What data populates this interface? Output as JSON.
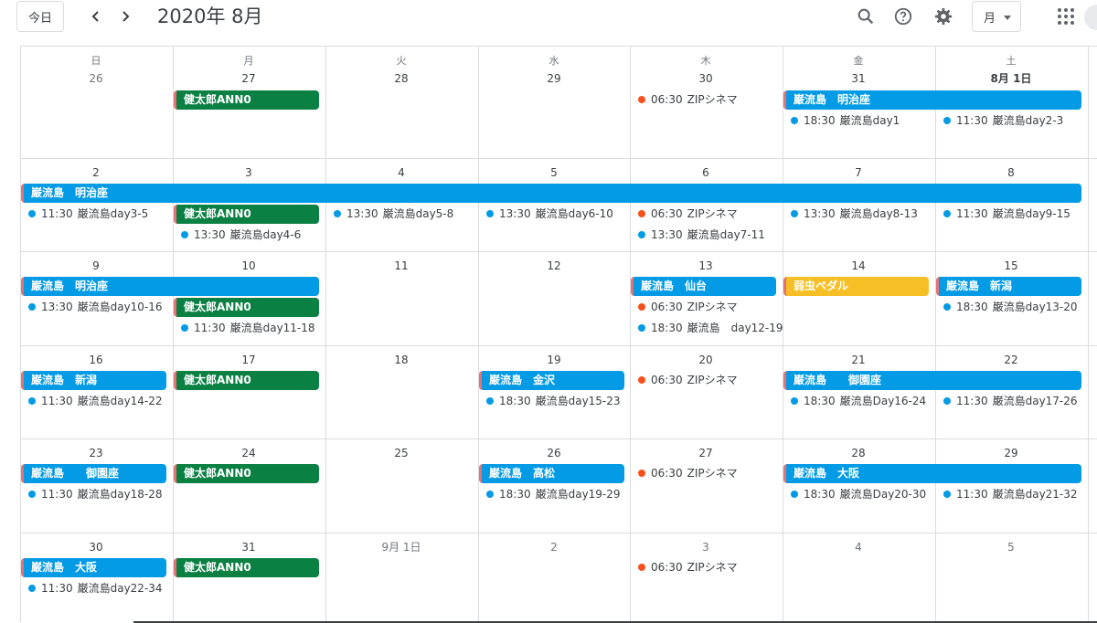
{
  "header": {
    "today_label": "今日",
    "title": "2020年 8月",
    "view_label": "月"
  },
  "colors": {
    "blue": "#039be5",
    "green": "#0b8043",
    "yellow": "#f6bf26",
    "dot_orange": "#f4511e",
    "dot_blue": "#039be5",
    "accent_edge": "#e57373"
  },
  "weekdays": [
    "日",
    "月",
    "火",
    "水",
    "木",
    "金",
    "土"
  ],
  "weeks": [
    {
      "days": [
        {
          "label": "26",
          "other": true
        },
        {
          "label": "27",
          "other": false
        },
        {
          "label": "28",
          "other": false
        },
        {
          "label": "29",
          "other": false
        },
        {
          "label": "30",
          "other": false
        },
        {
          "label": "31",
          "other": false
        },
        {
          "label": "8月 1日",
          "other": false,
          "strong": true
        }
      ],
      "bars": [
        {
          "col": 1,
          "span": 1,
          "row": 0,
          "text": "健太郎ANN0",
          "color": "green"
        },
        {
          "col": 5,
          "span": 2,
          "row": 0,
          "text": "巌流島　明治座",
          "color": "blue"
        }
      ],
      "timed": [
        {
          "col": 4,
          "row": 0,
          "time": "06:30",
          "text": "ZIPシネマ",
          "dot": "orange"
        },
        {
          "col": 5,
          "row": 1,
          "time": "18:30",
          "text": "巌流島day1",
          "dot": "blue"
        },
        {
          "col": 6,
          "row": 1,
          "time": "11:30",
          "text": "巌流島day2-3",
          "dot": "blue"
        }
      ]
    },
    {
      "days": [
        {
          "label": "2"
        },
        {
          "label": "3"
        },
        {
          "label": "4"
        },
        {
          "label": "5"
        },
        {
          "label": "6"
        },
        {
          "label": "7"
        },
        {
          "label": "8"
        }
      ],
      "bars": [
        {
          "col": 0,
          "span": 7,
          "row": 0,
          "text": "巌流島　明治座",
          "color": "blue"
        },
        {
          "col": 1,
          "span": 1,
          "row": 1,
          "text": "健太郎ANN0",
          "color": "green"
        }
      ],
      "timed": [
        {
          "col": 0,
          "row": 1,
          "time": "11:30",
          "text": "巌流島day3-5",
          "dot": "blue"
        },
        {
          "col": 1,
          "row": 2,
          "time": "13:30",
          "text": "巌流島day4-6",
          "dot": "blue"
        },
        {
          "col": 2,
          "row": 1,
          "time": "13:30",
          "text": "巌流島day5-8",
          "dot": "blue"
        },
        {
          "col": 3,
          "row": 1,
          "time": "13:30",
          "text": "巌流島day6-10",
          "dot": "blue"
        },
        {
          "col": 4,
          "row": 1,
          "time": "06:30",
          "text": "ZIPシネマ",
          "dot": "orange"
        },
        {
          "col": 4,
          "row": 2,
          "time": "13:30",
          "text": "巌流島day7-11",
          "dot": "blue"
        },
        {
          "col": 5,
          "row": 1,
          "time": "13:30",
          "text": "巌流島day8-13",
          "dot": "blue"
        },
        {
          "col": 6,
          "row": 1,
          "time": "11:30",
          "text": "巌流島day9-15",
          "dot": "blue"
        }
      ]
    },
    {
      "days": [
        {
          "label": "9"
        },
        {
          "label": "10"
        },
        {
          "label": "11"
        },
        {
          "label": "12"
        },
        {
          "label": "13"
        },
        {
          "label": "14"
        },
        {
          "label": "15"
        }
      ],
      "bars": [
        {
          "col": 0,
          "span": 2,
          "row": 0,
          "text": "巌流島　明治座",
          "color": "blue"
        },
        {
          "col": 1,
          "span": 1,
          "row": 1,
          "text": "健太郎ANN0",
          "color": "green"
        },
        {
          "col": 4,
          "span": 1,
          "row": 0,
          "text": "巌流島　仙台",
          "color": "blue"
        },
        {
          "col": 5,
          "span": 1,
          "row": 0,
          "text": "弱虫ペダル",
          "color": "yellow"
        },
        {
          "col": 6,
          "span": 1,
          "row": 0,
          "text": "巌流島　新潟",
          "color": "blue"
        }
      ],
      "timed": [
        {
          "col": 0,
          "row": 1,
          "time": "13:30",
          "text": "巌流島day10-16",
          "dot": "blue"
        },
        {
          "col": 1,
          "row": 2,
          "time": "11:30",
          "text": "巌流島day11-18",
          "dot": "blue"
        },
        {
          "col": 4,
          "row": 1,
          "time": "06:30",
          "text": "ZIPシネマ",
          "dot": "orange"
        },
        {
          "col": 4,
          "row": 2,
          "time": "18:30",
          "text": "巌流島　day12-19",
          "dot": "blue"
        },
        {
          "col": 6,
          "row": 1,
          "time": "18:30",
          "text": "巌流島day13-20",
          "dot": "blue"
        }
      ]
    },
    {
      "days": [
        {
          "label": "16"
        },
        {
          "label": "17"
        },
        {
          "label": "18"
        },
        {
          "label": "19"
        },
        {
          "label": "20"
        },
        {
          "label": "21"
        },
        {
          "label": "22"
        }
      ],
      "bars": [
        {
          "col": 0,
          "span": 1,
          "row": 0,
          "text": "巌流島　新潟",
          "color": "blue"
        },
        {
          "col": 1,
          "span": 1,
          "row": 0,
          "text": "健太郎ANN0",
          "color": "green"
        },
        {
          "col": 3,
          "span": 1,
          "row": 0,
          "text": "巌流島　金沢",
          "color": "blue"
        },
        {
          "col": 5,
          "span": 2,
          "row": 0,
          "text": "巌流島　　御園座",
          "color": "blue"
        }
      ],
      "timed": [
        {
          "col": 0,
          "row": 1,
          "time": "11:30",
          "text": "巌流島day14-22",
          "dot": "blue"
        },
        {
          "col": 3,
          "row": 1,
          "time": "18:30",
          "text": "巌流島day15-23",
          "dot": "blue"
        },
        {
          "col": 4,
          "row": 0,
          "time": "06:30",
          "text": "ZIPシネマ",
          "dot": "orange"
        },
        {
          "col": 5,
          "row": 1,
          "time": "18:30",
          "text": "巌流島Day16-24",
          "dot": "blue"
        },
        {
          "col": 6,
          "row": 1,
          "time": "11:30",
          "text": "巌流島day17-26",
          "dot": "blue"
        }
      ]
    },
    {
      "days": [
        {
          "label": "23"
        },
        {
          "label": "24"
        },
        {
          "label": "25"
        },
        {
          "label": "26"
        },
        {
          "label": "27"
        },
        {
          "label": "28"
        },
        {
          "label": "29"
        }
      ],
      "bars": [
        {
          "col": 0,
          "span": 1,
          "row": 0,
          "text": "巌流島　　御園座",
          "color": "blue"
        },
        {
          "col": 1,
          "span": 1,
          "row": 0,
          "text": "健太郎ANN0",
          "color": "green"
        },
        {
          "col": 3,
          "span": 1,
          "row": 0,
          "text": "巌流島　高松",
          "color": "blue"
        },
        {
          "col": 5,
          "span": 2,
          "row": 0,
          "text": "巌流島　大阪",
          "color": "blue"
        }
      ],
      "timed": [
        {
          "col": 0,
          "row": 1,
          "time": "11:30",
          "text": "巌流島day18-28",
          "dot": "blue"
        },
        {
          "col": 3,
          "row": 1,
          "time": "18:30",
          "text": "巌流島day19-29",
          "dot": "blue"
        },
        {
          "col": 4,
          "row": 0,
          "time": "06:30",
          "text": "ZIPシネマ",
          "dot": "orange"
        },
        {
          "col": 5,
          "row": 1,
          "time": "18:30",
          "text": "巌流島Day20-30",
          "dot": "blue"
        },
        {
          "col": 6,
          "row": 1,
          "time": "11:30",
          "text": "巌流島day21-32",
          "dot": "blue"
        }
      ]
    },
    {
      "days": [
        {
          "label": "30"
        },
        {
          "label": "31"
        },
        {
          "label": "9月 1日",
          "other": true
        },
        {
          "label": "2",
          "other": true
        },
        {
          "label": "3",
          "other": true
        },
        {
          "label": "4",
          "other": true
        },
        {
          "label": "5",
          "other": true
        }
      ],
      "bars": [
        {
          "col": 0,
          "span": 1,
          "row": 0,
          "text": "巌流島　大阪",
          "color": "blue"
        },
        {
          "col": 1,
          "span": 1,
          "row": 0,
          "text": "健太郎ANN0",
          "color": "green"
        }
      ],
      "timed": [
        {
          "col": 0,
          "row": 1,
          "time": "11:30",
          "text": "巌流島day22-34",
          "dot": "blue"
        },
        {
          "col": 4,
          "row": 0,
          "time": "06:30",
          "text": "ZIPシネマ",
          "dot": "orange"
        }
      ]
    }
  ]
}
